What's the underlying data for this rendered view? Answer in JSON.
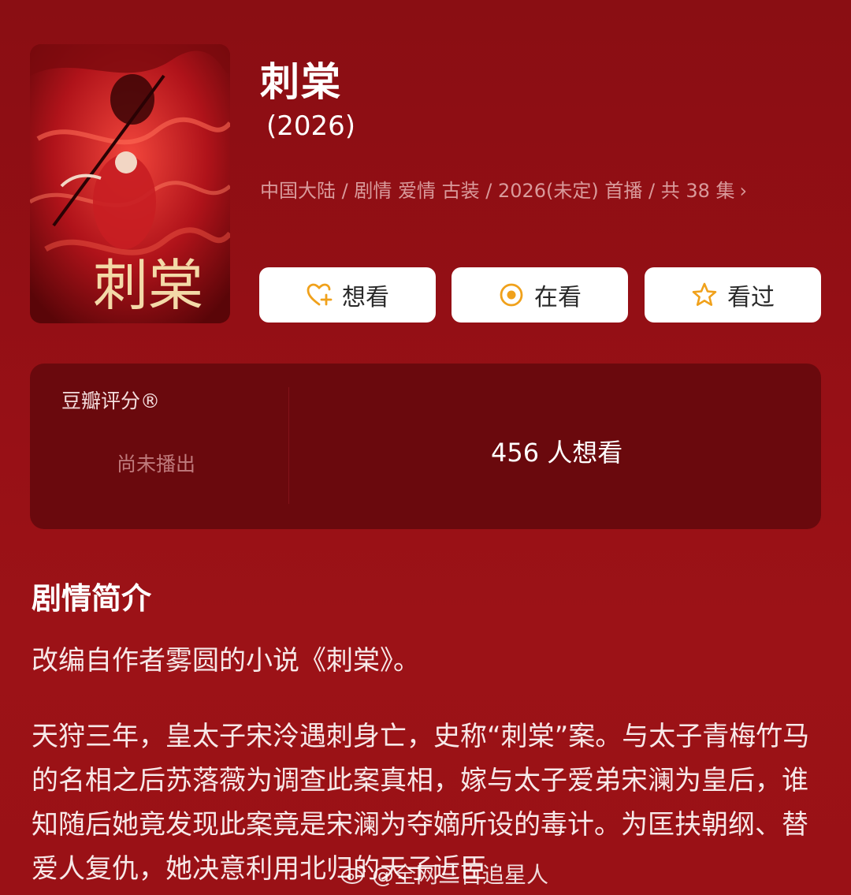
{
  "show": {
    "title": "刺棠",
    "year": "(2026)",
    "meta": "中国大陆 / 剧情 爱情 古装 / 2026(未定) 首播 / 共 38 集",
    "poster_text": "刺棠"
  },
  "actions": [
    {
      "label": "想看",
      "icon": "heart-plus-icon"
    },
    {
      "label": "在看",
      "icon": "target-icon"
    },
    {
      "label": "看过",
      "icon": "star-icon"
    }
  ],
  "rating": {
    "label": "豆瓣评分®",
    "status": "尚未播出",
    "want_count": "456 人想看"
  },
  "synopsis": {
    "heading": "剧情简介",
    "p1": "改编自作者雾圆的小说《刺棠》。",
    "p2": "天狩三年，皇太子宋泠遇刺身亡，史称“刺棠”案。与太子青梅竹马的名相之后苏落薇为调查此案真相，嫁与太子爱弟宋澜为皇后，谁知随后她竟发现此案竟是宋澜为夺嫡所设的毒计。为匡扶朝纲、替爱人复仇，她决意利用北归的天子近臣"
  },
  "watermark": {
    "text": "@全网三百追星人"
  },
  "colors": {
    "background": "#8a0e13",
    "rating_panel": "#6a090d",
    "button_bg": "#ffffff",
    "icon_accent": "#f0a11b"
  }
}
